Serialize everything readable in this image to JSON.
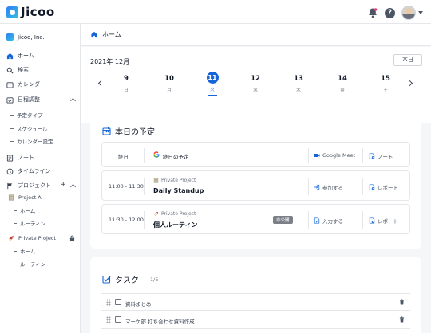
{
  "app": {
    "logo_text": "Jicoo",
    "brand_color": "#1565d8"
  },
  "topbar": {
    "icons": [
      "bell-icon",
      "help-icon",
      "avatar",
      "chevron-down-icon"
    ],
    "help_glyph": "?"
  },
  "sidebar": {
    "org_name": "Jicoo, Inc.",
    "home": "ホーム",
    "search": "検索",
    "calendar": "カレンダー",
    "scheduling": "日程調整",
    "scheduling_items": [
      "予定タイプ",
      "スケジュール",
      "カレンダー設定"
    ],
    "notes": "ノート",
    "timeline": "タイムライン",
    "projects": "プロジェクト",
    "project_a": {
      "name": "Project A",
      "items": [
        "ホーム",
        "ルーティン"
      ]
    },
    "private_project": {
      "name": "Private Project",
      "items": [
        "ホーム",
        "ルーティン"
      ]
    }
  },
  "page": {
    "title": "ホーム"
  },
  "datebar": {
    "month": "2021年 12月",
    "today_button": "本日",
    "days": [
      {
        "num": "9",
        "weekday": "日"
      },
      {
        "num": "10",
        "weekday": "月"
      },
      {
        "num": "11",
        "weekday": "火",
        "selected": true
      },
      {
        "num": "12",
        "weekday": "水"
      },
      {
        "num": "13",
        "weekday": "木"
      },
      {
        "num": "14",
        "weekday": "金"
      },
      {
        "num": "15",
        "weekday": "土"
      }
    ]
  },
  "schedule": {
    "title": "本日の予定",
    "allday": {
      "label": "終日",
      "event": "終日の予定",
      "meet": "Google Meet",
      "note": "ノート"
    },
    "events": [
      {
        "time": "11:00 - 11:30",
        "project": "Private Project",
        "name": "Daily Standup",
        "action": "参加する",
        "report": "レポート"
      },
      {
        "time": "11:30 - 12:00",
        "project": "Private Project",
        "name": "個人ルーティン",
        "badge": "非公開",
        "action": "入力する",
        "report": "レポート"
      }
    ]
  },
  "tasks": {
    "title": "タスク",
    "count": "1/5",
    "items": [
      "資料まとめ",
      "マーケ部 打ち合わせ資料作成"
    ]
  }
}
